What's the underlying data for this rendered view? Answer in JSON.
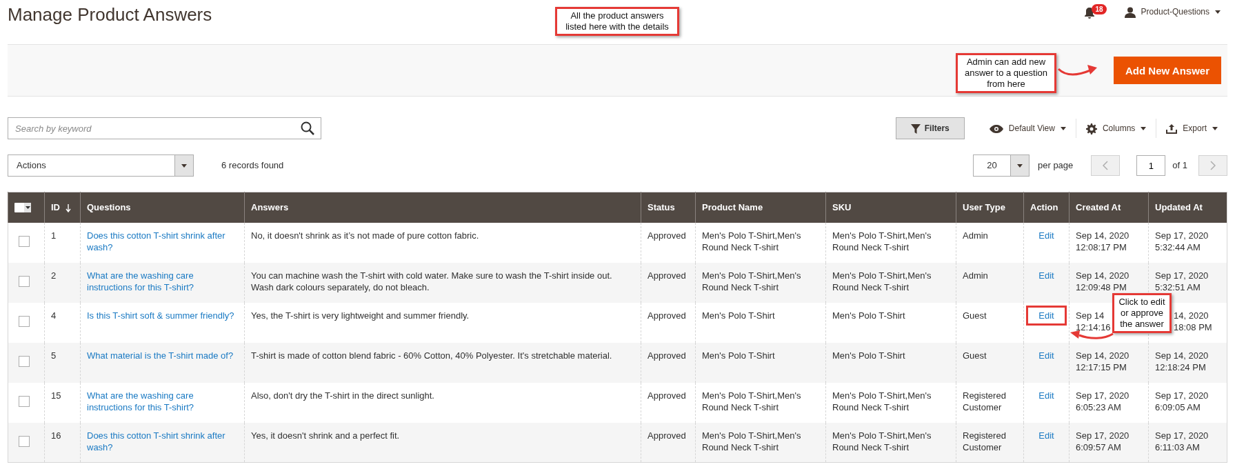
{
  "page_title": "Manage Product Answers",
  "header": {
    "notifications_count": "18",
    "user_name": "Product-Questions"
  },
  "add_button": {
    "label": "Add New Answer"
  },
  "annotations": [
    {
      "kind": "title",
      "text": "All the product answers listed here with the details"
    },
    {
      "kind": "add",
      "text": "Admin can add new answer to a question from here"
    },
    {
      "kind": "edit",
      "text": "Click to edit or approve the answer"
    }
  ],
  "search": {
    "placeholder": "Search by keyword"
  },
  "toolbar": {
    "filters_label": "Filters",
    "view_label": "Default View",
    "columns_label": "Columns",
    "export_label": "Export"
  },
  "actions_select": {
    "value": "Actions"
  },
  "records_found": "6 records found",
  "pagination": {
    "per_page_value": "20",
    "per_page_label": "per page",
    "page": "1",
    "of_label": "of 1"
  },
  "table": {
    "columns": [
      {
        "label": "ID",
        "sorted": true
      },
      {
        "label": "Questions",
        "sorted": false
      },
      {
        "label": "Answers",
        "sorted": false
      },
      {
        "label": "Status",
        "sorted": false
      },
      {
        "label": "Product Name",
        "sorted": false
      },
      {
        "label": "SKU",
        "sorted": false
      },
      {
        "label": "User Type",
        "sorted": false
      },
      {
        "label": "Action",
        "sorted": false
      },
      {
        "label": "Created At",
        "sorted": false
      },
      {
        "label": "Updated At",
        "sorted": false
      }
    ],
    "rows": [
      {
        "checked": false,
        "id": "1",
        "question": "Does this cotton T-shirt shrink after wash?",
        "answer": "No, it doesn't shrink as it’s not made of pure cotton fabric.",
        "status": "Approved",
        "product_name": "Men's Polo T-Shirt,Men's Round Neck T-shirt",
        "sku": "Men's Polo T-Shirt,Men's Round Neck T-shirt",
        "user_type": "Admin",
        "action": "Edit",
        "highlighted": false,
        "created_date": "Sep 14, 2020",
        "created_time": "12:08:17 PM",
        "updated_date": "Sep 17, 2020",
        "updated_time": "5:32:44 AM"
      },
      {
        "checked": false,
        "id": "2",
        "question": "What are the washing care instructions for this T-shirt?",
        "answer": "You can machine wash the T-shirt with cold water. Make sure to wash the T-shirt inside out. Wash dark colours separately, do not bleach.",
        "status": "Approved",
        "product_name": "Men's Polo T-Shirt,Men's Round Neck T-shirt",
        "sku": "Men's Polo T-Shirt,Men's Round Neck T-shirt",
        "user_type": "Admin",
        "action": "Edit",
        "highlighted": false,
        "created_date": "Sep 14, 2020",
        "created_time": "12:09:48 PM",
        "updated_date": "Sep 17, 2020",
        "updated_time": "5:32:51 AM"
      },
      {
        "checked": false,
        "id": "4",
        "question": "Is this T-shirt soft & summer friendly?",
        "answer": "Yes, the T-shirt is very lightweight and summer friendly.",
        "status": "Approved",
        "product_name": "Men's Polo T-Shirt",
        "sku": "Men's Polo T-Shirt",
        "user_type": "Guest",
        "action": "Edit",
        "highlighted": true,
        "created_date": "Sep 14",
        "created_time": "12:14:16",
        "updated_date": "14, 2020",
        "updated_time": "18:08 PM"
      },
      {
        "checked": false,
        "id": "5",
        "question": "What material is the T-shirt made of?",
        "answer": "T-shirt is made of cotton blend fabric - 60% Cotton, 40% Polyester. It's stretchable material.",
        "status": "Approved",
        "product_name": "Men's Polo T-Shirt",
        "sku": "Men's Polo T-Shirt",
        "user_type": "Guest",
        "action": "Edit",
        "highlighted": false,
        "created_date": "Sep 14, 2020",
        "created_time": "12:17:15 PM",
        "updated_date": "Sep 14, 2020",
        "updated_time": "12:18:24 PM"
      },
      {
        "checked": false,
        "id": "15",
        "question": "What are the washing care instructions for this T-shirt?",
        "answer": "Also, don't dry the T-shirt in the direct sunlight.",
        "status": "Approved",
        "product_name": "Men's Polo T-Shirt,Men's Round Neck T-shirt",
        "sku": "Men's Polo T-Shirt,Men's Round Neck T-shirt",
        "user_type": "Registered Customer",
        "action": "Edit",
        "highlighted": false,
        "created_date": "Sep 17, 2020",
        "created_time": "6:05:23 AM",
        "updated_date": "Sep 17, 2020",
        "updated_time": "6:09:05 AM"
      },
      {
        "checked": false,
        "id": "16",
        "question": "Does this cotton T-shirt shrink after wash?",
        "answer": "Yes, it doesn't shrink and a perfect fit.",
        "status": "Approved",
        "product_name": "Men's Polo T-Shirt,Men's Round Neck T-shirt",
        "sku": "Men's Polo T-Shirt,Men's Round Neck T-shirt",
        "user_type": "Registered Customer",
        "action": "Edit",
        "highlighted": false,
        "created_date": "Sep 17, 2020",
        "created_time": "6:09:57 AM",
        "updated_date": "Sep 17, 2020",
        "updated_time": "6:11:03 AM"
      }
    ]
  }
}
